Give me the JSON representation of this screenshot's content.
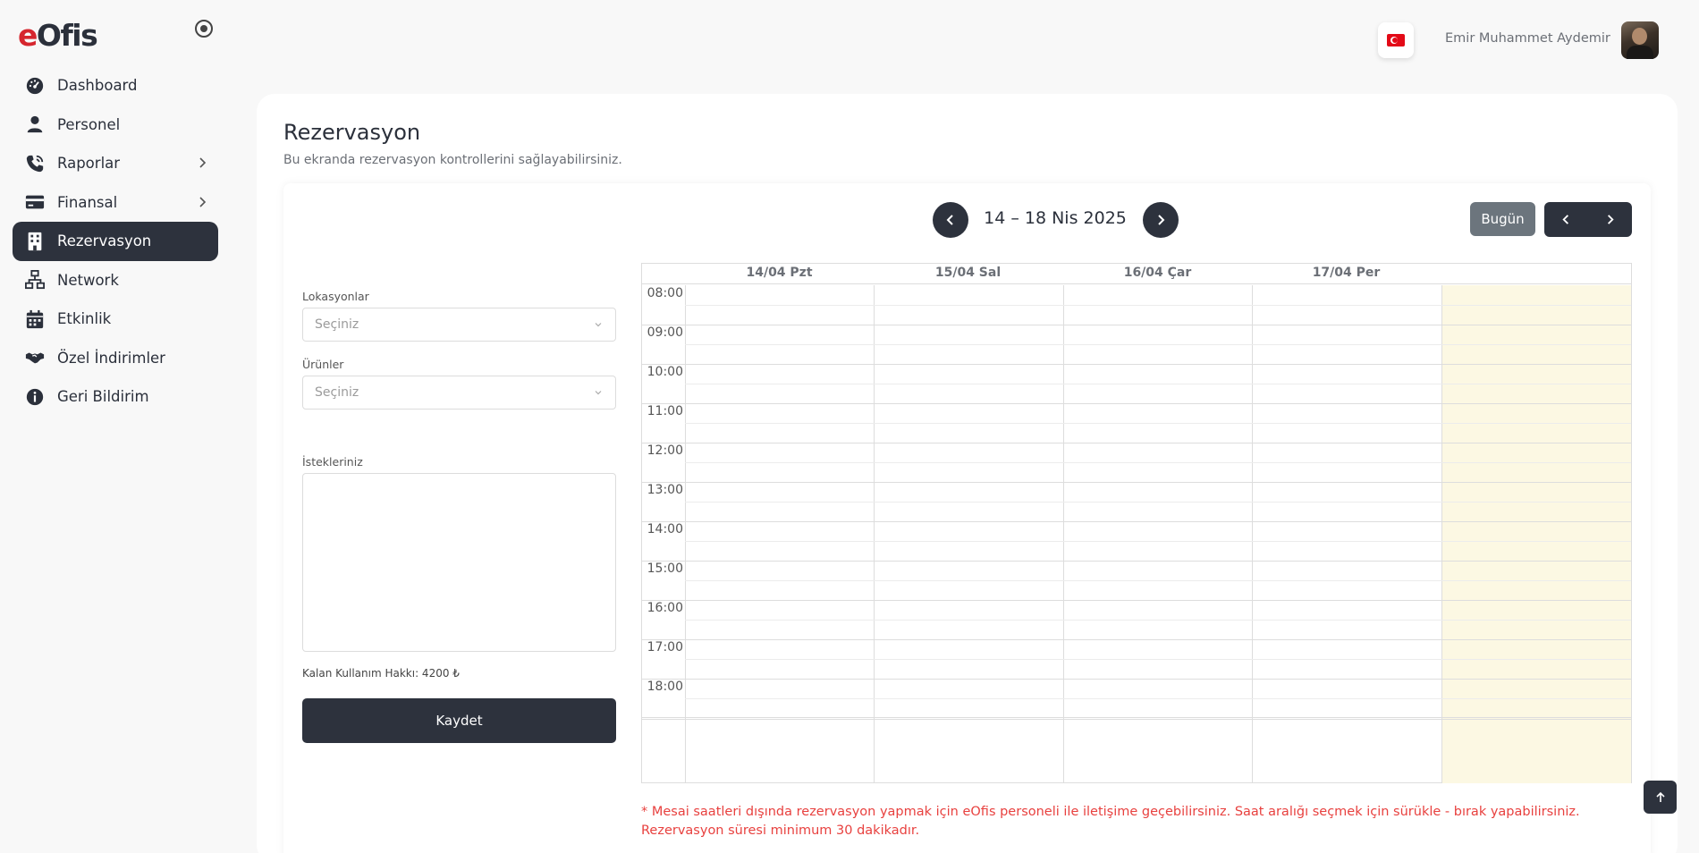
{
  "logo": {
    "e": "e",
    "rest": "Ofis"
  },
  "sidebar": {
    "items": [
      {
        "label": "Dashboard",
        "icon": "gauge-icon"
      },
      {
        "label": "Personel",
        "icon": "user-icon"
      },
      {
        "label": "Raporlar",
        "icon": "phone-icon",
        "has_submenu": true
      },
      {
        "label": "Finansal",
        "icon": "credit-card-icon",
        "has_submenu": true
      },
      {
        "label": "Rezervasyon",
        "icon": "building-icon",
        "active": true
      },
      {
        "label": "Network",
        "icon": "network-icon"
      },
      {
        "label": "Etkinlik",
        "icon": "calendar-icon"
      },
      {
        "label": "Özel İndirimler",
        "icon": "handshake-icon"
      },
      {
        "label": "Geri Bildirim",
        "icon": "info-icon"
      }
    ]
  },
  "header": {
    "user_name": "Emir Muhammet Aydemir",
    "language_flag": "turkey-flag-icon"
  },
  "page": {
    "title": "Rezervasyon",
    "subtitle": "Bu ekranda rezervasyon kontrollerini sağlayabilirsiniz."
  },
  "calendar_nav": {
    "date_range": "14 – 18 Nis 2025",
    "today_label": "Bugün"
  },
  "form": {
    "locations_label": "Lokasyonlar",
    "locations_placeholder": "Seçiniz",
    "products_label": "Ürünler",
    "products_placeholder": "Seçiniz",
    "requests_label": "İstekleriniz",
    "requests_value": "",
    "remaining_label": "Kalan Kullanım Hakkı: 4200 ₺",
    "save_label": "Kaydet"
  },
  "calendar": {
    "days": [
      "14/04 Pzt",
      "15/04 Sal",
      "16/04 Çar",
      "17/04 Per",
      ""
    ],
    "times": [
      "08:00",
      "09:00",
      "10:00",
      "11:00",
      "12:00",
      "13:00",
      "14:00",
      "15:00",
      "16:00",
      "17:00",
      "18:00"
    ],
    "today_highlight_color": "#fcf8e3"
  },
  "notice": {
    "line1": "* Mesai saatleri dışında rezervasyon yapmak için eOfis personeli ile iletişime geçebilirsiniz. Saat aralığı seçmek için sürükle - bırak yapabilirsiniz.",
    "line2": "Rezervasyon süresi minimum 30 dakikadır."
  },
  "colors": {
    "primary_dark": "#2d323d",
    "notice_red": "#e8413f",
    "today_button": "#6c757d"
  }
}
